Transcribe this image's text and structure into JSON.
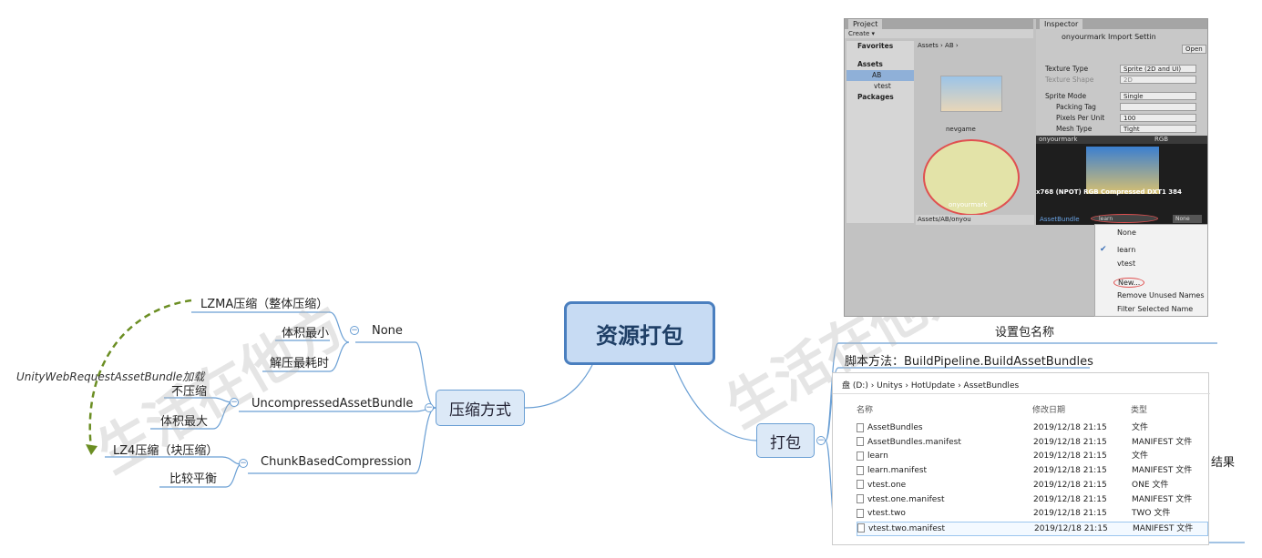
{
  "root": {
    "title": "资源打包"
  },
  "left": {
    "branch": "压缩方式",
    "options": [
      {
        "name": "None",
        "notes": [
          "体积最小",
          "解压最耗时"
        ],
        "format": "LZMA压缩（整体压缩）"
      },
      {
        "name": "UncompressedAssetBundle",
        "notes": [
          "不压缩",
          "体积最大"
        ]
      },
      {
        "name": "ChunkBasedCompression",
        "notes": [
          "比较平衡"
        ],
        "format": "LZ4压缩（块压缩）"
      }
    ],
    "relation_label": "UnityWebRequestAssetBundle加载"
  },
  "right": {
    "branch": "打包",
    "set_name_label": "设置包名称",
    "script_method": "脚本方法：BuildPipeline.BuildAssetBundles",
    "result_label": "结果"
  },
  "unity": {
    "project_tab": "Project",
    "create_button": "Create ▾",
    "favorites": "Favorites",
    "breadcrumb": "Assets  ›  AB  ›",
    "tree": [
      "Assets",
      "AB",
      "vtest",
      "Packages"
    ],
    "asset_top_label": "nevgame",
    "asset_selected_label": "onyourmark",
    "path_bar": "Assets/AB/onyou",
    "inspector_tab": "Inspector",
    "inspector_title": "onyourmark Import Settin",
    "open_button": "Open",
    "props": [
      {
        "label": "Texture Type",
        "value": "Sprite (2D and UI)"
      },
      {
        "label": "Texture Shape",
        "value": "2D"
      },
      {
        "label": "Sprite Mode",
        "value": "Single"
      },
      {
        "label": "Packing Tag",
        "value": ""
      },
      {
        "label": "Pixels Per Unit",
        "value": "100"
      },
      {
        "label": "Mesh Type",
        "value": "Tight"
      }
    ],
    "preview_title": "onyourmark",
    "preview_channels": "RGB",
    "preview_info": "x768 (NPOT)  RGB Compressed DXT1  384",
    "asset_bundle_label": "AssetBundle",
    "asset_bundle_value": "learn",
    "asset_bundle_variant": "None",
    "menu": [
      "None",
      "learn",
      "vtest",
      "New...",
      "Remove Unused Names",
      "Filter Selected Name"
    ],
    "menu_checked": "learn"
  },
  "explorer": {
    "path": "盘 (D:)  ›  Unitys  ›  HotUpdate  ›  AssetBundles",
    "columns": [
      "名称",
      "修改日期",
      "类型"
    ],
    "files": [
      {
        "name": "AssetBundles",
        "date": "2019/12/18 21:15",
        "type": "文件"
      },
      {
        "name": "AssetBundles.manifest",
        "date": "2019/12/18 21:15",
        "type": "MANIFEST 文件"
      },
      {
        "name": "learn",
        "date": "2019/12/18 21:15",
        "type": "文件"
      },
      {
        "name": "learn.manifest",
        "date": "2019/12/18 21:15",
        "type": "MANIFEST 文件"
      },
      {
        "name": "vtest.one",
        "date": "2019/12/18 21:15",
        "type": "ONE 文件"
      },
      {
        "name": "vtest.one.manifest",
        "date": "2019/12/18 21:15",
        "type": "MANIFEST 文件"
      },
      {
        "name": "vtest.two",
        "date": "2019/12/18 21:15",
        "type": "TWO 文件"
      },
      {
        "name": "vtest.two.manifest",
        "date": "2019/12/18 21:15",
        "type": "MANIFEST 文件"
      }
    ]
  },
  "watermark": "生活在他方",
  "colors": {
    "root_border": "#4a7fbf",
    "root_fill": "#c7dbf3",
    "branch_fill": "#dce9f7",
    "line": "#6a9fd4",
    "dashed": "#6b8e23",
    "highlight": "#e05050"
  }
}
